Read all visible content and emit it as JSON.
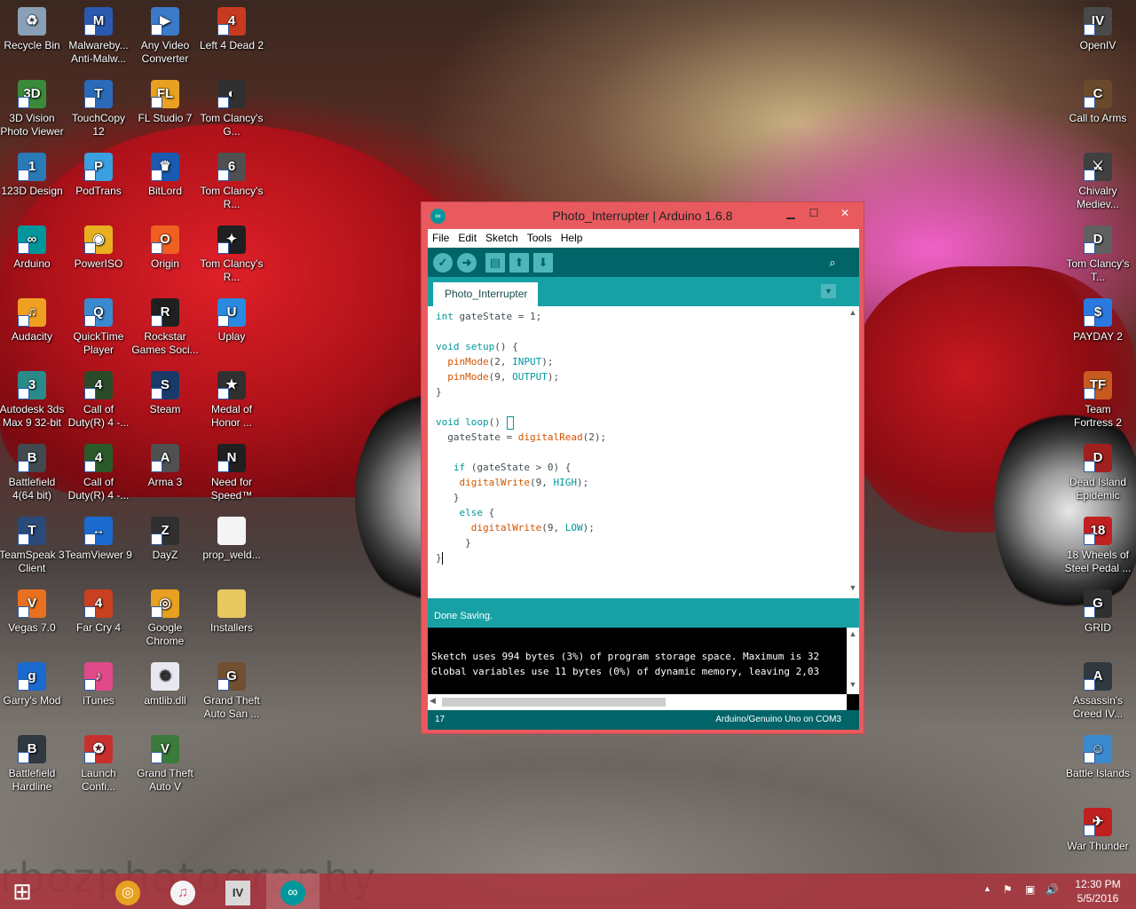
{
  "desktop": {
    "icons_left": [
      {
        "label": "Recycle Bin",
        "icon": "recycle-bin-icon",
        "color": "#8aa0b8",
        "glyph": "♻"
      },
      {
        "label": "Malwareby... Anti-Malw...",
        "icon": "malwarebytes-icon",
        "color": "#2a5ab0",
        "glyph": "M"
      },
      {
        "label": "Any Video Converter",
        "icon": "any-video-converter-icon",
        "color": "#3a7ac8",
        "glyph": "▶"
      },
      {
        "label": "Left 4 Dead 2",
        "icon": "left4dead2-icon",
        "color": "#c83a20",
        "glyph": "4"
      },
      {
        "label": "3D Vision Photo Viewer",
        "icon": "3d-vision-icon",
        "color": "#3a8a3a",
        "glyph": "3D"
      },
      {
        "label": "TouchCopy 12",
        "icon": "touchcopy-icon",
        "color": "#2a6ab8",
        "glyph": "T"
      },
      {
        "label": "FL Studio 7",
        "icon": "fl-studio-icon",
        "color": "#e8a020",
        "glyph": "FL"
      },
      {
        "label": "Tom Clancy's G...",
        "icon": "tom-clancy-ghost-icon",
        "color": "#303030",
        "glyph": "◐"
      },
      {
        "label": "123D Design",
        "icon": "123d-design-icon",
        "color": "#2a7ab8",
        "glyph": "1"
      },
      {
        "label": "PodTrans",
        "icon": "podtrans-icon",
        "color": "#3aa0e0",
        "glyph": "P"
      },
      {
        "label": "BitLord",
        "icon": "bitlord-icon",
        "color": "#1a5ab0",
        "glyph": "♛"
      },
      {
        "label": "Tom Clancy's R...",
        "icon": "tom-clancy-rainbow-icon",
        "color": "#505050",
        "glyph": "6"
      },
      {
        "label": "Arduino",
        "icon": "arduino-icon",
        "color": "#00979c",
        "glyph": "∞"
      },
      {
        "label": "PowerISO",
        "icon": "poweriso-icon",
        "color": "#e8b020",
        "glyph": "◉"
      },
      {
        "label": "Origin",
        "icon": "origin-icon",
        "color": "#f06020",
        "glyph": "O"
      },
      {
        "label": "Tom Clancy's R...",
        "icon": "tom-clancy-rainbow2-icon",
        "color": "#202020",
        "glyph": "✦"
      },
      {
        "label": "Audacity",
        "icon": "audacity-icon",
        "color": "#f0a020",
        "glyph": "♫"
      },
      {
        "label": "QuickTime Player",
        "icon": "quicktime-icon",
        "color": "#3a8ad0",
        "glyph": "Q"
      },
      {
        "label": "Rockstar Games Soci...",
        "icon": "rockstar-icon",
        "color": "#202020",
        "glyph": "R"
      },
      {
        "label": "Uplay",
        "icon": "uplay-icon",
        "color": "#2a8ae0",
        "glyph": "U"
      },
      {
        "label": "Autodesk 3ds Max 9 32-bit",
        "icon": "autodesk-3ds-icon",
        "color": "#2a8a8a",
        "glyph": "3"
      },
      {
        "label": "Call of Duty(R) 4 -...",
        "icon": "call-of-duty-icon",
        "color": "#2a4a2a",
        "glyph": "4"
      },
      {
        "label": "Steam",
        "icon": "steam-icon",
        "color": "#1a3a6a",
        "glyph": "S"
      },
      {
        "label": "Medal of Honor ...",
        "icon": "medal-of-honor-icon",
        "color": "#303030",
        "glyph": "★"
      },
      {
        "label": "Battlefield 4(64 bit)",
        "icon": "battlefield4-icon",
        "color": "#404a50",
        "glyph": "B"
      },
      {
        "label": "Call of Duty(R) 4 -...",
        "icon": "call-of-duty2-icon",
        "color": "#2a5a2a",
        "glyph": "4"
      },
      {
        "label": "Arma 3",
        "icon": "arma3-icon",
        "color": "#505050",
        "glyph": "A"
      },
      {
        "label": "Need for Speed™",
        "icon": "need-for-speed-icon",
        "color": "#202020",
        "glyph": "N"
      },
      {
        "label": "TeamSpeak 3 Client",
        "icon": "teamspeak-icon",
        "color": "#2a4a7a",
        "glyph": "T"
      },
      {
        "label": "TeamViewer 9",
        "icon": "teamviewer-icon",
        "color": "#1a6ad0",
        "glyph": "↔"
      },
      {
        "label": "DayZ",
        "icon": "dayz-icon",
        "color": "#303030",
        "glyph": "Z"
      },
      {
        "label": "prop_weld...",
        "icon": "file-icon",
        "color": "#f4f4f4",
        "glyph": ""
      },
      {
        "label": "Vegas 7.0",
        "icon": "vegas-icon",
        "color": "#e87020",
        "glyph": "V"
      },
      {
        "label": "Far Cry 4",
        "icon": "far-cry-icon",
        "color": "#c84020",
        "glyph": "4"
      },
      {
        "label": "Google Chrome",
        "icon": "chrome-icon",
        "color": "#e8a020",
        "glyph": "◎"
      },
      {
        "label": "Installers",
        "icon": "folder-icon",
        "color": "#e8c860",
        "glyph": ""
      },
      {
        "label": "Garry's Mod",
        "icon": "garrys-mod-icon",
        "color": "#1a6ad0",
        "glyph": "g"
      },
      {
        "label": "iTunes",
        "icon": "itunes-icon",
        "color": "#e04a8a",
        "glyph": "♪"
      },
      {
        "label": "amtlib.dll",
        "icon": "dll-icon",
        "color": "#e8e8f0",
        "glyph": "⚙"
      },
      {
        "label": "Grand Theft Auto San ...",
        "icon": "gta-san-andreas-icon",
        "color": "#705030",
        "glyph": "G"
      },
      {
        "label": "Battlefield Hardline",
        "icon": "battlefield-hardline-icon",
        "color": "#303840",
        "glyph": "B"
      },
      {
        "label": "Launch Confi...",
        "icon": "launch-config-icon",
        "color": "#c83030",
        "glyph": "✪"
      },
      {
        "label": "Grand Theft Auto V",
        "icon": "gta-v-icon",
        "color": "#3a7a3a",
        "glyph": "V"
      }
    ],
    "icons_right": [
      {
        "label": "OpenIV",
        "icon": "openiv-icon",
        "color": "#4a4a4a",
        "glyph": "IV"
      },
      {
        "label": "Call to Arms",
        "icon": "call-to-arms-icon",
        "color": "#6a4a2a",
        "glyph": "C"
      },
      {
        "label": "Chivalry Mediev...",
        "icon": "chivalry-icon",
        "color": "#404040",
        "glyph": "⚔"
      },
      {
        "label": "Tom Clancy's T...",
        "icon": "tom-clancy-division-icon",
        "color": "#606060",
        "glyph": "D"
      },
      {
        "label": "PAYDAY 2",
        "icon": "payday2-icon",
        "color": "#2a7ae0",
        "glyph": "$"
      },
      {
        "label": "Team Fortress 2",
        "icon": "team-fortress-icon",
        "color": "#c85a20",
        "glyph": "TF"
      },
      {
        "label": "Dead Island Epidemic",
        "icon": "dead-island-icon",
        "color": "#a02020",
        "glyph": "D"
      },
      {
        "label": "18 Wheels of Steel Pedal ...",
        "icon": "18-wheels-icon",
        "color": "#c02020",
        "glyph": "18"
      },
      {
        "label": "GRID",
        "icon": "grid-icon",
        "color": "#303030",
        "glyph": "G"
      },
      {
        "label": "Assassin's Creed IV...",
        "icon": "assassins-creed-icon",
        "color": "#303840",
        "glyph": "A"
      },
      {
        "label": "Battle Islands",
        "icon": "battle-islands-icon",
        "color": "#3a8ad0",
        "glyph": "☺"
      },
      {
        "label": "War Thunder",
        "icon": "war-thunder-icon",
        "color": "#c02020",
        "glyph": "✈"
      }
    ],
    "watermark": "rbozphotography"
  },
  "window": {
    "title": "Photo_Interrupter | Arduino 1.6.8",
    "minimize": "▁",
    "maximize": "☐",
    "close": "✕",
    "menu": [
      "File",
      "Edit",
      "Sketch",
      "Tools",
      "Help"
    ],
    "toolbar": {
      "verify": "✓",
      "upload": "➜",
      "new": "▤",
      "open": "⬆",
      "save": "⬇",
      "serial_monitor": "⌕"
    },
    "tab_name": "Photo_Interrupter",
    "tab_menu": "▼",
    "status_message": "Done Saving.",
    "console_lines": [
      "Sketch uses 994 bytes (3%) of program storage space. Maximum is 32",
      "Global variables use 11 bytes (0%) of dynamic memory, leaving 2,03"
    ],
    "line_number": "17",
    "board": "Arduino/Genuino Uno on COM3"
  },
  "taskbar": {
    "start": "⊞",
    "apps": [
      {
        "name": "chrome",
        "glyph": "◎",
        "color": "#e8a020"
      },
      {
        "name": "itunes",
        "glyph": "♫",
        "color": "#e04a8a"
      },
      {
        "name": "openiv",
        "glyph": "IV",
        "color": "#5a5a5a"
      },
      {
        "name": "arduino",
        "glyph": "∞",
        "color": "#00979c"
      }
    ],
    "tray": {
      "up": "▲",
      "flag": "⚑",
      "network": "▣",
      "volume": "🔊"
    },
    "time": "12:30 PM",
    "date": "5/5/2016"
  }
}
